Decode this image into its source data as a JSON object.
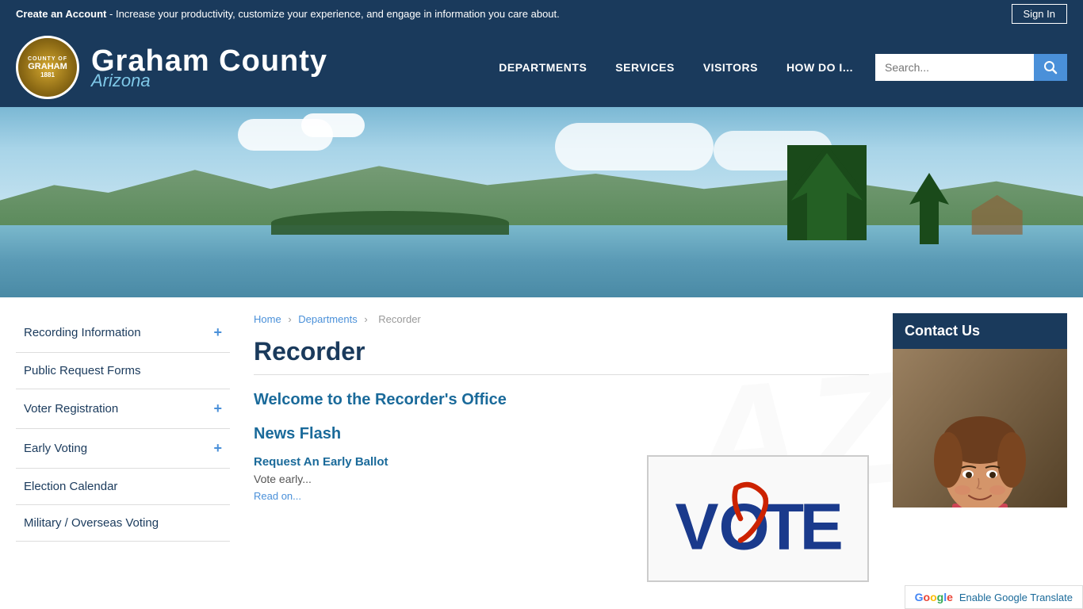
{
  "top_banner": {
    "create_account_label": "Create an Account",
    "banner_text": " - Increase your productivity, customize your experience, and engage in information you care about.",
    "sign_in_label": "Sign In"
  },
  "header": {
    "site_name_main": "Graham County",
    "site_name_sub": "Arizona",
    "logo_text": "County of Graham",
    "logo_year": "1881",
    "nav_items": [
      {
        "label": "DEPARTMENTS",
        "id": "departments"
      },
      {
        "label": "SERVICES",
        "id": "services"
      },
      {
        "label": "VISITORS",
        "id": "visitors"
      },
      {
        "label": "HOW DO I...",
        "id": "how-do-i"
      }
    ],
    "search_placeholder": "Search..."
  },
  "breadcrumb": {
    "home": "Home",
    "departments": "Departments",
    "current": "Recorder",
    "separator": "›"
  },
  "page": {
    "title": "Recorder",
    "welcome_heading": "Welcome to the Recorder's Office",
    "news_flash_heading": "News Flash",
    "news_item_title": "Request An Early Ballot",
    "news_item_text": "Vote early...",
    "news_item_read_more": "Read on...",
    "vote_graphic_text": "VOTE"
  },
  "sidebar": {
    "items": [
      {
        "label": "Recording Information",
        "has_expand": true,
        "id": "recording-information"
      },
      {
        "label": "Public Request Forms",
        "has_expand": false,
        "id": "public-request-forms"
      },
      {
        "label": "Voter Registration",
        "has_expand": true,
        "id": "voter-registration"
      },
      {
        "label": "Early Voting",
        "has_expand": true,
        "id": "early-voting"
      },
      {
        "label": "Election Calendar",
        "has_expand": false,
        "id": "election-calendar"
      },
      {
        "label": "Military / Overseas Voting",
        "has_expand": false,
        "id": "military-overseas"
      }
    ]
  },
  "contact": {
    "title": "Contact Us"
  },
  "translate": {
    "label": "Enable Google Translate"
  }
}
